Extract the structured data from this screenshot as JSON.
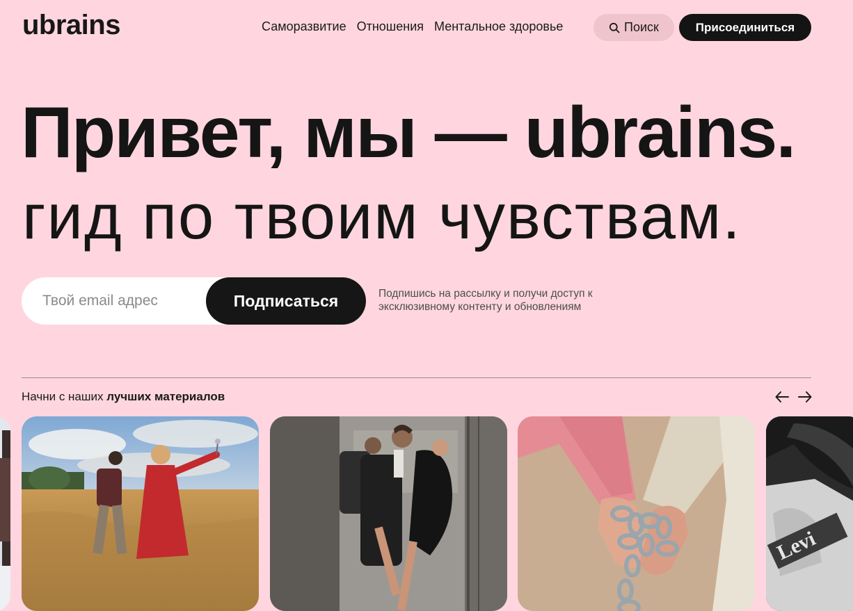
{
  "header": {
    "logo": "ubrains",
    "nav": [
      {
        "label": "Саморазвитие"
      },
      {
        "label": "Отношения"
      },
      {
        "label": "Ментальное здоровье"
      }
    ],
    "search_label": "Поиск",
    "join_label": "Присоединиться"
  },
  "hero": {
    "title": "Привет, мы — ubrains.",
    "subtitle": "гид по твоим чувствам."
  },
  "subscribe": {
    "email_placeholder": "Твой email адрес",
    "email_value": "",
    "button_label": "Подписаться",
    "note": "Подпишись на рассылку и получи доступ к эксклюзивному контенту и обновлениям"
  },
  "materials": {
    "label_prefix": "Начни с наших",
    "label_bold": "лучших материалов",
    "cards": [
      {
        "image": "winter-trees-photo"
      },
      {
        "image": "couple-in-wheat-field-photo"
      },
      {
        "image": "couple-in-elevator-photo"
      },
      {
        "image": "chained-hands-photo"
      },
      {
        "image": "man-in-levis-shirt-photo"
      }
    ]
  },
  "icons": {
    "search": "search-icon",
    "prev": "arrow-left-icon",
    "next": "arrow-right-icon"
  },
  "colors": {
    "background": "#ffd6df",
    "primary_dark": "#141414",
    "search_bg": "#f0c4cd",
    "input_bg": "#ffffff"
  }
}
